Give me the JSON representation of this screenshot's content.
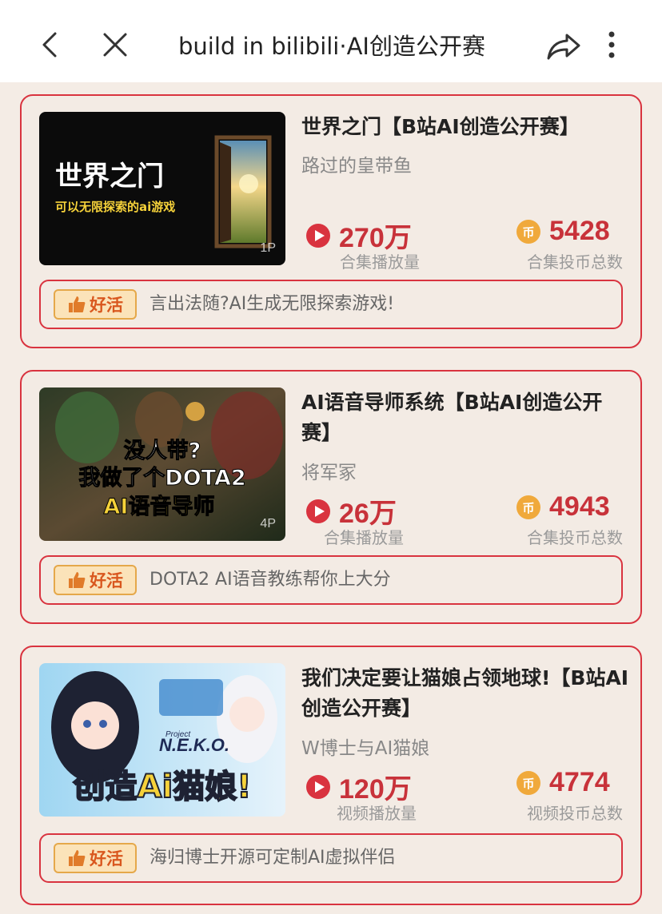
{
  "topbar": {
    "title": "build in bilibili·AI创造公开赛"
  },
  "cards": [
    {
      "title": "世界之门【B站AI创造公开赛】",
      "author": "路过的皇带鱼",
      "thumb_line1": "世界之门",
      "thumb_line2": "可以无限探索的ai游戏",
      "parts": "1P",
      "plays": "270万",
      "plays_label": "合集播放量",
      "coins": "5428",
      "coins_label": "合集投币总数",
      "tag": "好活",
      "recommend": "言出法随?AI生成无限探索游戏!"
    },
    {
      "title": "AI语音导师系统【B站AI创造公开赛】",
      "author": "将军冢",
      "thumb_line1": "没人带?",
      "thumb_line2": "我做了个DOTA2",
      "thumb_line3": "AI语音导师",
      "parts": "4P",
      "plays": "26万",
      "plays_label": "合集播放量",
      "coins": "4943",
      "coins_label": "合集投币总数",
      "tag": "好活",
      "recommend": "DOTA2 AI语音教练帮你上大分"
    },
    {
      "title": "我们决定要让猫娘占领地球!【B站AI创造公开赛】",
      "author": "W博士与AI猫娘",
      "thumb_line1": "Project",
      "thumb_line2": "N.E.K.O.",
      "thumb_line3": "创造Ai猫娘!",
      "plays": "120万",
      "plays_label": "视频播放量",
      "coins": "4774",
      "coins_label": "视频投币总数",
      "tag": "好活",
      "recommend": "海归博士开源可定制AI虚拟伴侣"
    }
  ],
  "colors": {
    "accent": "#d9333f",
    "number": "#c8323a",
    "coin": "#f0a93b",
    "tag_bg": "#fbe3b9"
  },
  "icons": {
    "back": "chevron-left-icon",
    "close": "close-icon",
    "share": "share-icon",
    "more": "more-vertical-icon",
    "play": "play-circle-icon",
    "coin": "coin-icon",
    "thumbs_up": "thumbs-up-icon"
  }
}
